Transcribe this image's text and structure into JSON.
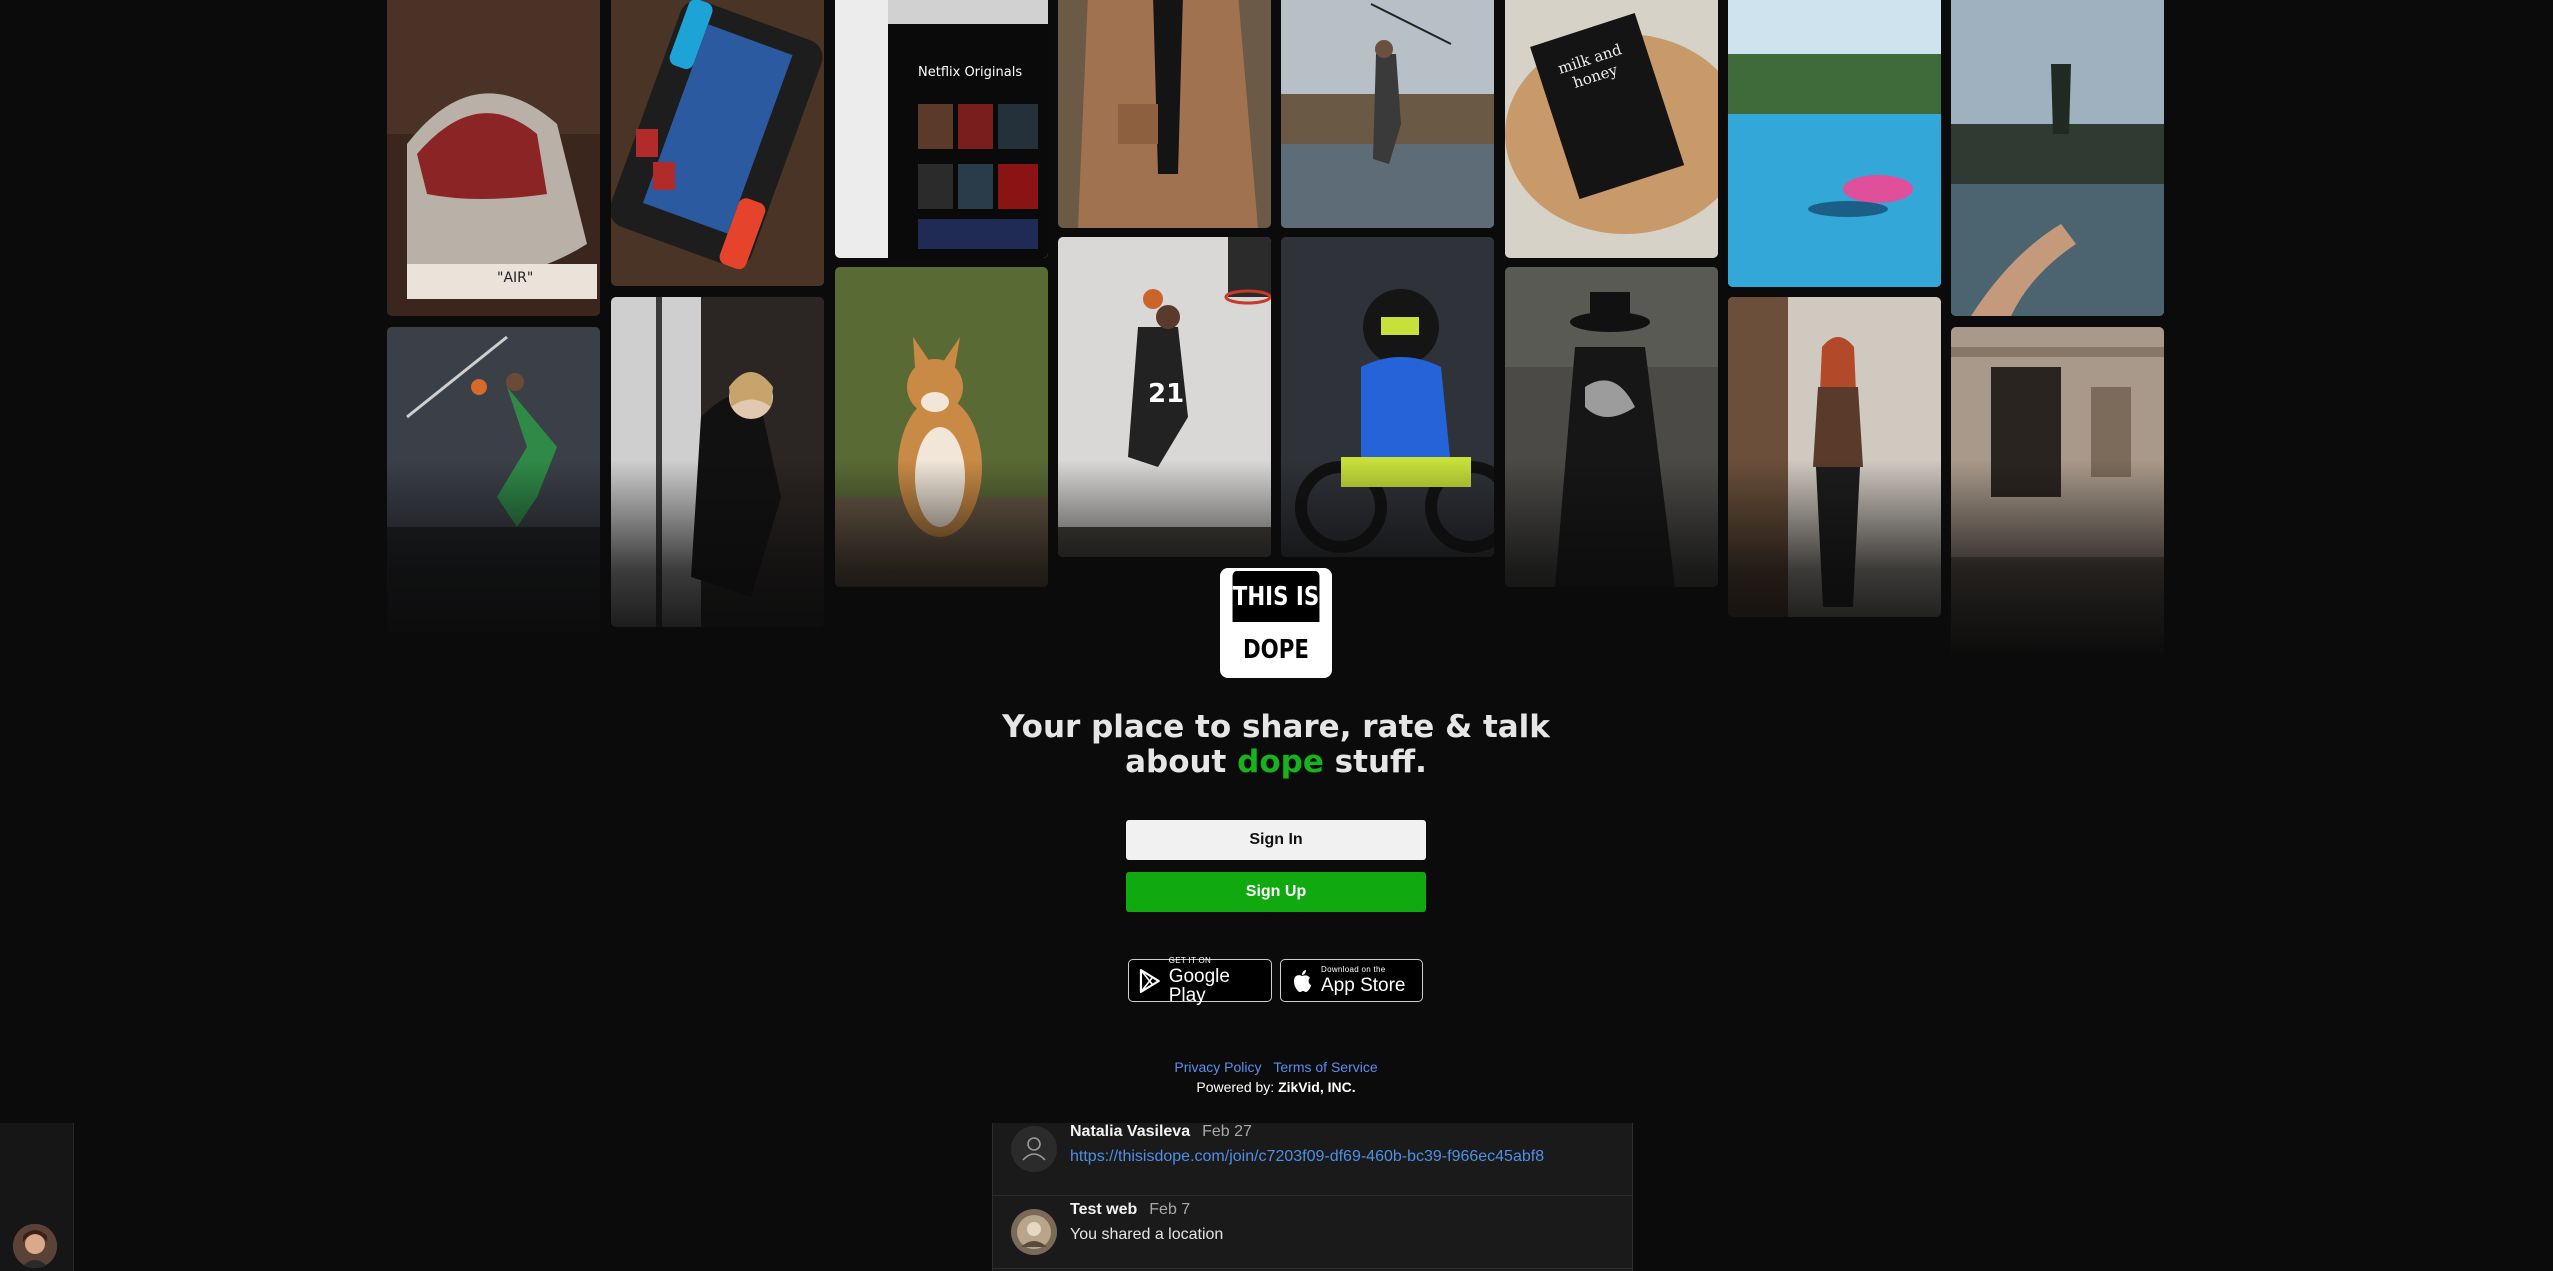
{
  "brand": {
    "logo_top": "THIS IS",
    "logo_bottom": "DOPE"
  },
  "tagline": {
    "part1": "Your place to share, rate & talk",
    "part2_before": "about ",
    "accent": "dope",
    "part2_after": " stuff."
  },
  "auth": {
    "signin_label": "Sign In",
    "signup_label": "Sign Up"
  },
  "stores": {
    "google_small": "GET IT ON",
    "google_big": "Google Play",
    "apple_small": "Download on the",
    "apple_big": "App Store"
  },
  "footer": {
    "privacy": "Privacy Policy",
    "terms": "Terms of Service",
    "powered_prefix": "Powered by: ",
    "powered_company": "ZikVid, INC."
  },
  "collage": {
    "photos": [
      "sneaker",
      "game-console",
      "streaming-tv",
      "coat-person",
      "fisherman",
      "book",
      "pool",
      "lake",
      "basketball-player-green",
      "woman-window",
      "corgi",
      "basketball-dunk",
      "motocross-rider",
      "hat-man",
      "redhead-woman",
      "old-building"
    ]
  },
  "chat": {
    "messages": [
      {
        "name": "Natalia Vasileva",
        "date": "Feb 27",
        "text": "https://thisisdope.com/join/c7203f09-df69-460b-bc39-f966ec45abf8"
      },
      {
        "name": "Test web",
        "date": "Feb 7",
        "text": "You shared a location"
      }
    ]
  },
  "colors": {
    "accent": "#16b41a",
    "signup": "#10a910",
    "link": "#5b8ef0",
    "background": "#0b0b0b"
  }
}
